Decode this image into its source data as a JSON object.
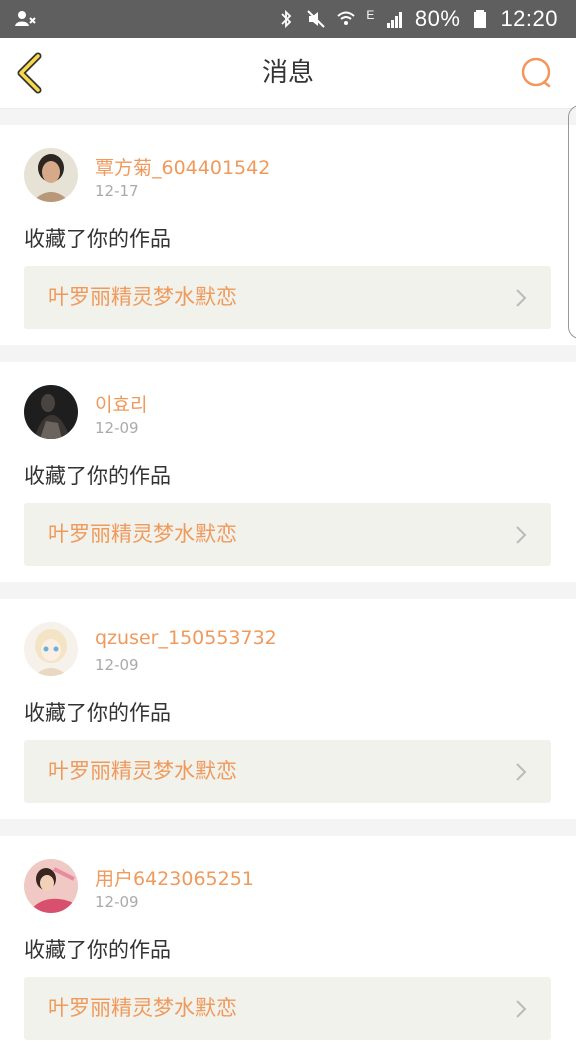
{
  "status_bar": {
    "battery": "80%",
    "time": "12:20",
    "network": "E"
  },
  "header": {
    "title": "消息"
  },
  "messages": [
    {
      "username": "覃方菊_604401542",
      "date": "12-17",
      "action": "收藏了你的作品",
      "work_title": "叶罗丽精灵梦水默恋"
    },
    {
      "username": "이효리",
      "date": "12-09",
      "action": "收藏了你的作品",
      "work_title": "叶罗丽精灵梦水默恋"
    },
    {
      "username": "qzuser_150553732",
      "date": "12-09",
      "action": "收藏了你的作品",
      "work_title": "叶罗丽精灵梦水默恋"
    },
    {
      "username": "用户6423065251",
      "date": "12-09",
      "action": "收藏了你的作品",
      "work_title": "叶罗丽精灵梦水默恋"
    }
  ],
  "colors": {
    "accent": "#ef9a5c",
    "status_bar": "#5f5f5f",
    "card_link_bg": "#f2f2ec"
  }
}
